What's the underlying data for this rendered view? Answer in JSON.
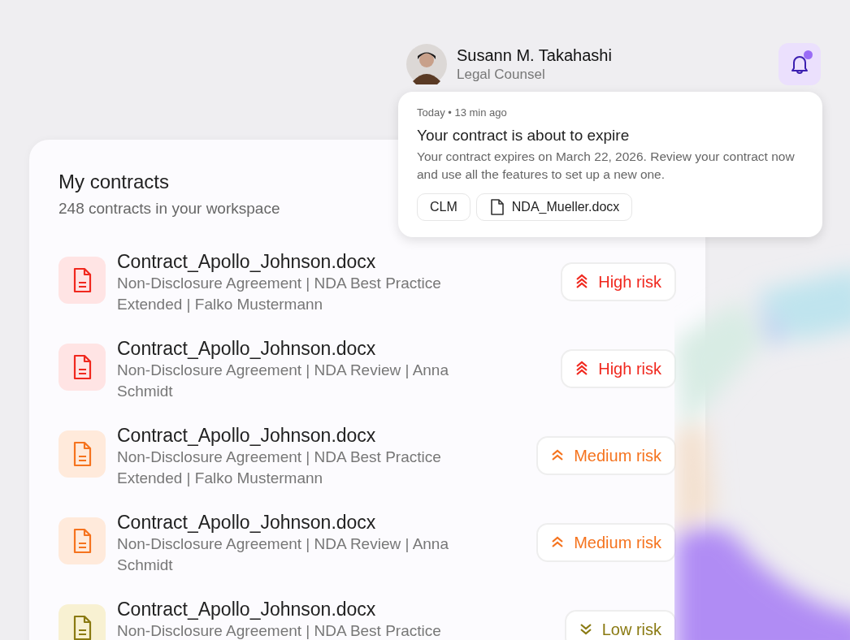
{
  "user": {
    "name": "Susann M. Takahashi",
    "role": "Legal Counsel"
  },
  "notification_button": {
    "unread": true
  },
  "notification": {
    "time": "Today • 13 min ago",
    "title": "Your contract is about to expire",
    "body": "Your contract expires on March 22, 2026. Review your contract now and use all the features to set up a new one.",
    "tags": [
      {
        "label": "CLM",
        "kind": "tag"
      },
      {
        "label": "NDA_Mueller.docx",
        "kind": "file"
      }
    ]
  },
  "contracts": {
    "title": "My contracts",
    "subtitle": "248 contracts in your workspace",
    "rows": [
      {
        "name": "Contract_Apollo_Johnson.docx",
        "details": "Non-Disclosure Agreement | NDA Best Practice Extended | Falko Mustermann",
        "kind": "high",
        "risk_label": "High risk"
      },
      {
        "name": "Contract_Apollo_Johnson.docx",
        "details": "Non-Disclosure Agreement | NDA Review | Anna Schmidt",
        "kind": "high",
        "risk_label": "High risk"
      },
      {
        "name": "Contract_Apollo_Johnson.docx",
        "details": "Non-Disclosure Agreement | NDA Best Practice Extended | Falko Mustermann",
        "kind": "medium",
        "risk_label": "Medium risk"
      },
      {
        "name": "Contract_Apollo_Johnson.docx",
        "details": "Non-Disclosure Agreement | NDA Review | Anna Schmidt",
        "kind": "medium",
        "risk_label": "Medium risk"
      },
      {
        "name": "Contract_Apollo_Johnson.docx",
        "details": "Non-Disclosure Agreement | NDA Best Practice",
        "kind": "low",
        "risk_label": "Low risk"
      }
    ]
  }
}
